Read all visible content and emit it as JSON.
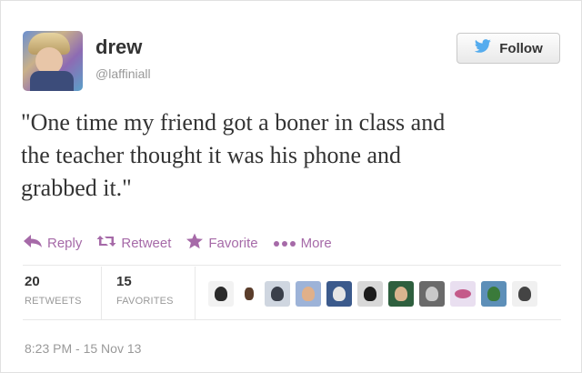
{
  "user": {
    "name": "drew",
    "handle": "@laffiniall"
  },
  "follow_button": {
    "label": "Follow",
    "icon": "twitter-bird-icon",
    "icon_color": "#55acee"
  },
  "tweet": {
    "text": "\"One time my friend got a boner in class and\nthe teacher thought it was his phone and\ngrabbed it.\""
  },
  "actions": [
    {
      "label": "Reply",
      "icon": "reply-icon"
    },
    {
      "label": "Retweet",
      "icon": "retweet-icon"
    },
    {
      "label": "Favorite",
      "icon": "star-icon"
    },
    {
      "label": "More",
      "icon": "more-dots-icon"
    }
  ],
  "action_color": "#a66aa8",
  "stats": {
    "retweets": {
      "count": "20",
      "label": "RETWEETS"
    },
    "favorites": {
      "count": "15",
      "label": "FAVORITES"
    }
  },
  "favoriters_count": 11,
  "timestamp": "8:23 PM - 15 Nov 13"
}
